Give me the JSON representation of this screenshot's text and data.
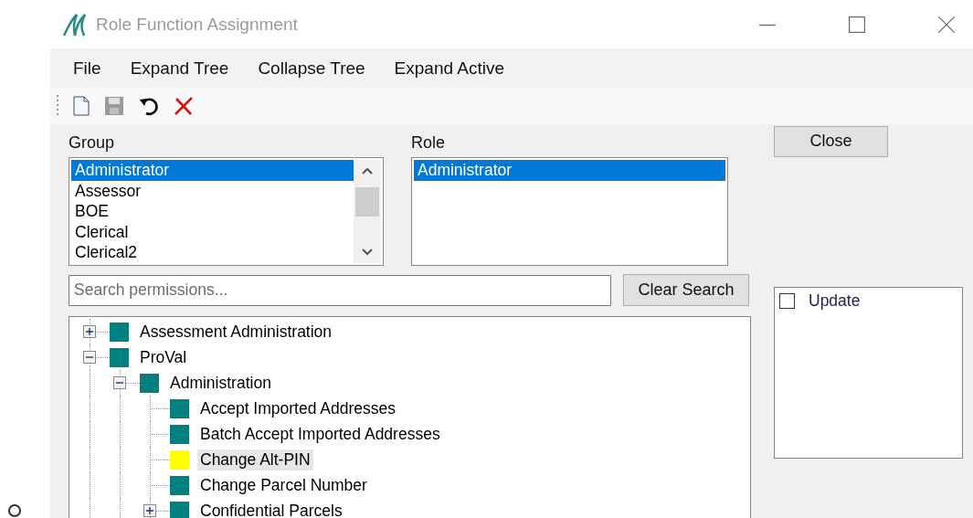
{
  "window": {
    "title": "Role Function Assignment"
  },
  "menu": [
    "File",
    "Expand Tree",
    "Collapse Tree",
    "Expand Active"
  ],
  "toolbar": [
    {
      "kind": "new",
      "disabled": false
    },
    {
      "kind": "save",
      "disabled": true
    },
    {
      "kind": "undo",
      "disabled": false
    },
    {
      "kind": "delete",
      "disabled": false
    }
  ],
  "close_button": "Close",
  "group": {
    "label": "Group",
    "items": [
      {
        "label": "Administrator",
        "selected": true
      },
      {
        "label": "Assessor",
        "selected": false
      },
      {
        "label": "BOE",
        "selected": false
      },
      {
        "label": "Clerical",
        "selected": false
      },
      {
        "label": "Clerical2",
        "selected": false
      }
    ]
  },
  "role": {
    "label": "Role",
    "items": [
      {
        "label": "Administrator",
        "selected": true
      }
    ]
  },
  "search": {
    "placeholder": "Search permissions..."
  },
  "clear_search_button": "Clear Search",
  "tree": [
    {
      "label": "Assessment Administration",
      "color": "#008080",
      "selected": false,
      "expanded": false
    },
    {
      "label": "ProVal",
      "color": "#008080",
      "selected": false,
      "expanded": true,
      "children": [
        {
          "label": "Administration",
          "color": "#008080",
          "selected": false,
          "expanded": true,
          "children": [
            {
              "label": "Accept Imported Addresses",
              "color": "#008080",
              "selected": false
            },
            {
              "label": "Batch Accept Imported Addresses",
              "color": "#008080",
              "selected": false
            },
            {
              "label": "Change Alt-PIN",
              "color": "#ffff00",
              "selected": true
            },
            {
              "label": "Change Parcel Number",
              "color": "#008080",
              "selected": false
            },
            {
              "label": "Confidential Parcels",
              "color": "#008080",
              "selected": false,
              "expanded": false
            }
          ]
        }
      ]
    }
  ],
  "options": [
    {
      "label": "Update",
      "checked": false
    }
  ]
}
